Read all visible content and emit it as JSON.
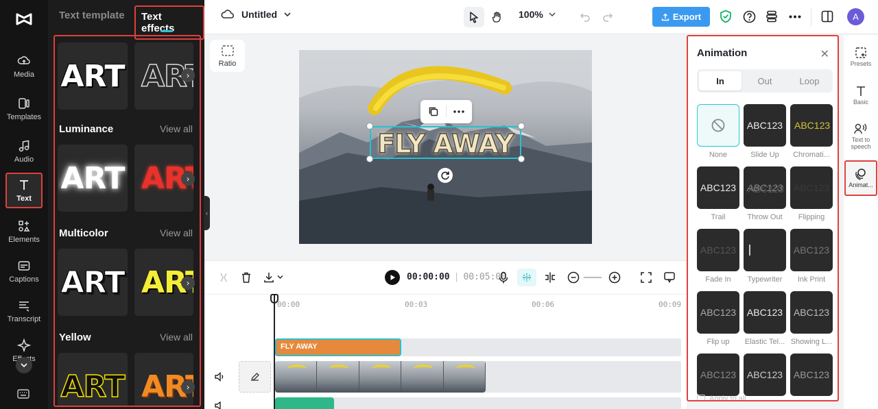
{
  "app": {
    "project_title": "Untitled",
    "zoom": "100%",
    "export_label": "Export",
    "avatar_initial": "A"
  },
  "rail": {
    "items": [
      {
        "label": "Media",
        "icon": "cloud-upload-icon"
      },
      {
        "label": "Templates",
        "icon": "template-icon"
      },
      {
        "label": "Audio",
        "icon": "music-note-icon"
      },
      {
        "label": "Text",
        "icon": "text-t-icon"
      },
      {
        "label": "Elements",
        "icon": "elements-icon"
      },
      {
        "label": "Captions",
        "icon": "captions-icon"
      },
      {
        "label": "Transcript",
        "icon": "transcript-icon"
      },
      {
        "label": "Effects",
        "icon": "sparkle-icon"
      }
    ]
  },
  "panel": {
    "tabs": [
      "Text template",
      "Text effects"
    ],
    "active_tab": "Text effects",
    "tile_text": "ART",
    "categories": [
      {
        "title": "Luminance",
        "view_all": "View all"
      },
      {
        "title": "Multicolor",
        "view_all": "View all"
      },
      {
        "title": "Yellow",
        "view_all": "View all"
      }
    ]
  },
  "canvas": {
    "ratio_label": "Ratio",
    "overlay_text": "FLY AWAY"
  },
  "timeline": {
    "current_time": "00:00:00",
    "duration": "00:05:00",
    "ruler": [
      "00:00",
      "00:03",
      "00:06",
      "00:09"
    ],
    "text_clip_label": "FLY AWAY"
  },
  "animation": {
    "title": "Animation",
    "tabs": [
      "In",
      "Out",
      "Loop"
    ],
    "active_tab": "In",
    "sample_text": "ABC123",
    "items": [
      {
        "label": "None"
      },
      {
        "label": "Slide Up"
      },
      {
        "label": "Chromati..."
      },
      {
        "label": "Trail"
      },
      {
        "label": "Throw Out"
      },
      {
        "label": "Flipping"
      },
      {
        "label": "Fade In"
      },
      {
        "label": "Typewriter"
      },
      {
        "label": "Ink Print"
      },
      {
        "label": "Flip up"
      },
      {
        "label": "Elastic Tel..."
      },
      {
        "label": "Showing L..."
      },
      {
        "label": ""
      },
      {
        "label": ""
      },
      {
        "label": ""
      }
    ],
    "apply_all": "Apply to all"
  },
  "side_rail": {
    "items": [
      {
        "label": "Presets"
      },
      {
        "label": "Basic"
      },
      {
        "label": "Text to speech"
      },
      {
        "label": "Animat..."
      }
    ]
  },
  "colors": {
    "accent": "#26c2cf",
    "highlight": "#e0403c",
    "export": "#3b9af0",
    "text_clip": "#e6893c"
  }
}
